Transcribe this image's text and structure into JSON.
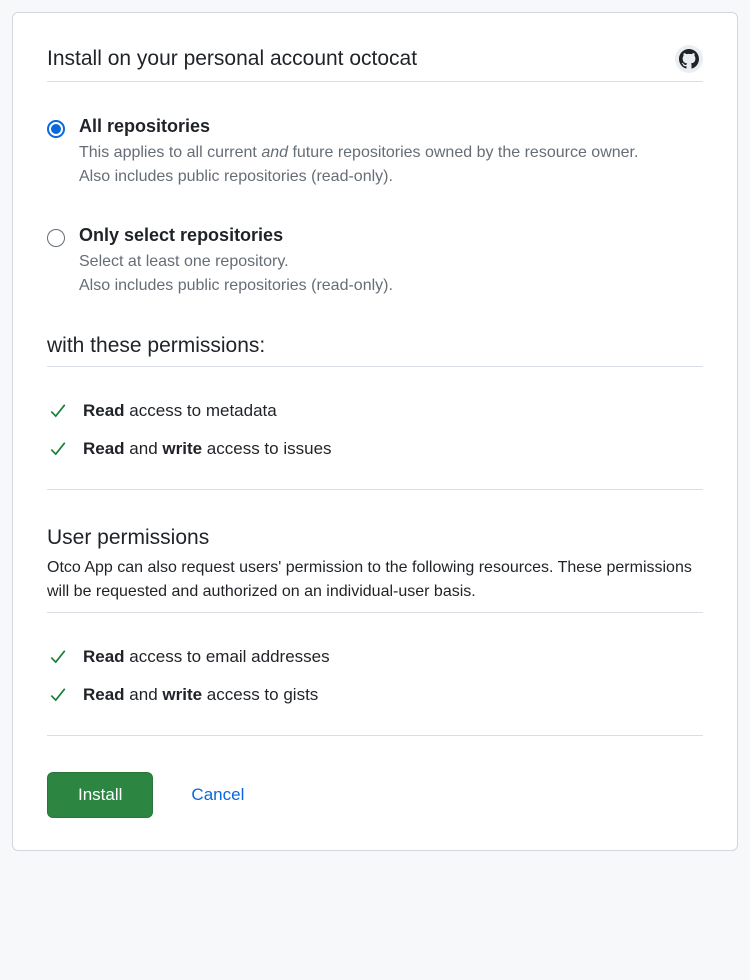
{
  "header": {
    "title": "Install on your personal account octocat"
  },
  "repo_scope": {
    "all": {
      "label": "All repositories",
      "desc_before": "This applies to all current ",
      "desc_em": "and",
      "desc_after": " future repositories owned by the resource owner.",
      "extra": "Also includes public repositories (read-only)."
    },
    "select": {
      "label": "Only select repositories",
      "desc": "Select at least one repository.",
      "extra": "Also includes public repositories (read-only)."
    }
  },
  "permissions_heading": "with these permissions:",
  "permissions": [
    {
      "prefix_bold": "Read",
      "rest": " access to metadata"
    },
    {
      "prefix_bold": "Read",
      "mid": " and ",
      "mid_bold": "write",
      "rest": " access to issues"
    }
  ],
  "user_permissions": {
    "heading": "User permissions",
    "desc": "Otco App can also request users' permission to the following resources. These permissions will be requested and authorized on an individual-user basis.",
    "items": [
      {
        "prefix_bold": "Read",
        "rest": " access to email addresses"
      },
      {
        "prefix_bold": "Read",
        "mid": " and ",
        "mid_bold": "write",
        "rest": " access to gists"
      }
    ]
  },
  "actions": {
    "install": "Install",
    "cancel": "Cancel"
  }
}
